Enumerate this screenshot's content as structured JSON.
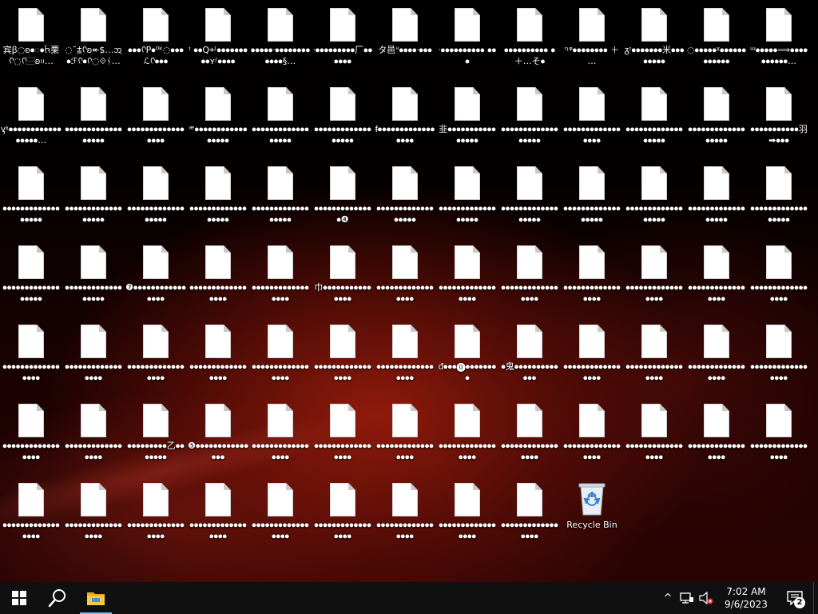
{
  "desktop": {
    "icons": [
      {
        "label": "宾ꞵ◌ꞝ⦁ᢆ⦁ᨪ栗ᢉ◌ᢉ⿱ꞝ᱿…",
        "type": "file"
      },
      {
        "label": "◌˘⩲ᢉꞝ↞$…ᩋ⦁ℱᢉ⦁ᢉ◌⟐ᚾ…",
        "type": "file"
      },
      {
        "label": "⦁⦁⦁ᢉP⦁⁰ᵏ◌⦁⦁⦁ℒᢉ⦁⦁⦁",
        "type": "file"
      },
      {
        "label": "ᶦ ⦁⦁Q⌖ᶴ⦁⦁⦁⦁⦁⦁⦁⦁⦁ʏᶴ⦁⦁⦁⦁",
        "type": "file"
      },
      {
        "label": "⦁⦁⦁⦁⦁ᐧ⦁⦁⦁⦁⦁⦁⦁⦁⦁⦁⦁⦁§…",
        "type": "file"
      },
      {
        "label": "ᐧ⦁⦁⦁⦁⦁⦁⦁⦁⦁厂⦁⦁⦁⦁⦁⦁",
        "type": "file"
      },
      {
        "label": "タ邑ᐡ⦁⦁⦁⦁ᐧ⦁⦁⦁",
        "type": "file"
      },
      {
        "label": "ᐧ⦁⦁⦁⦁⦁⦁⦁⦁⦁⦁ ⦁⦁⦁",
        "type": "file"
      },
      {
        "label": "⦁⦁⦁⦁⦁⦁⦁⦁⦁⦁ ⦁ ＋…そ⦁",
        "type": "file"
      },
      {
        "label": "ᶯᵠ⦁⦁⦁⦁⦁⦁⦁⦁ ＋ …",
        "type": "file"
      },
      {
        "label": "ᵹᶦ⦁⦁⦁⦁⦁⦁⦁米⦁⦁⦁⦁⦁⦁⦁⦁",
        "type": "file"
      },
      {
        "label": "◌⦁⦁⦁⦁⦁ᵡ⦁⦁⦁⦁⦁⦁⦁⦁⦁⦁⦁⦁",
        "type": "file"
      },
      {
        "label": "ᵚ⦁⦁⦁⦁⦁⟹⦁⦁⦁⦁⦁⦁⦁⦁⦁⦁…",
        "type": "file"
      },
      {
        "label": "ᶌᵡ⦁⦁⦁⦁⦁⦁⦁⦁⦁⦁⦁⦁⦁⦁⦁⦁⦁…",
        "type": "file"
      },
      {
        "label": "⦁⦁⦁⦁⦁⦁⦁⦁⦁⦁⦁⦁⦁⦁⦁⦁⦁⦁",
        "type": "file"
      },
      {
        "label": "⦁⦁⦁⦁⦁⦁⦁⦁⦁⦁⦁⦁⦁⦁⦁⦁⦁",
        "type": "file"
      },
      {
        "label": "ᵆ⦁⦁⦁⦁⦁⦁⦁⦁⦁⦁⦁⦁⦁⦁⦁⦁⦁",
        "type": "file"
      },
      {
        "label": "⦁⦁⦁⦁⦁⦁⦁⦁⦁⦁⦁⦁⦁⦁⦁⦁⦁⦁",
        "type": "file"
      },
      {
        "label": "⦁⦁⦁⦁⦁⦁⦁⦁⦁⦁⦁⦁⦁⦁⦁⦁⦁⦁",
        "type": "file"
      },
      {
        "label": "ᵮ⦁⦁⦁⦁⦁⦁⦁⦁⦁⦁⦁⦁⦁⦁⦁⦁⦁",
        "type": "file"
      },
      {
        "label": "韭⦁⦁⦁⦁⦁⦁⦁⦁⦁⦁⦁⦁⦁⦁⦁⦁",
        "type": "file"
      },
      {
        "label": "⦁⦁⦁⦁⦁⦁⦁⦁⦁⦁⦁⦁⦁⦁⦁⦁⦁⦁",
        "type": "file"
      },
      {
        "label": "⦁⦁⦁⦁⦁⦁⦁⦁⦁⦁⦁⦁⦁⦁⦁⦁⦁",
        "type": "file"
      },
      {
        "label": "⦁⦁⦁⦁⦁⦁⦁⦁⦁⦁⦁⦁⦁⦁⦁⦁⦁⦁",
        "type": "file"
      },
      {
        "label": "⦁⦁⦁⦁⦁⦁⦁⦁⦁⦁⦁⦁⦁⦁⦁⦁⦁⦁",
        "type": "file"
      },
      {
        "label": "⦁⦁⦁⦁⦁⦁⦁⦁⦁⦁⦁羽➡⦁⦁⦁",
        "type": "file"
      },
      {
        "label": "⦁⦁⦁⦁⦁⦁⦁⦁⦁⦁⦁⦁⦁⦁⦁⦁⦁⦁",
        "type": "file"
      },
      {
        "label": "⦁⦁⦁⦁⦁⦁⦁⦁⦁⦁⦁⦁⦁⦁⦁⦁⦁⦁",
        "type": "file"
      },
      {
        "label": "⦁⦁⦁⦁⦁⦁⦁⦁⦁⦁⦁⦁⦁⦁⦁⦁⦁⦁",
        "type": "file"
      },
      {
        "label": "⦁⦁⦁⦁⦁⦁⦁⦁⦁⦁⦁⦁⦁⦁⦁⦁⦁⦁",
        "type": "file"
      },
      {
        "label": "⦁⦁⦁⦁⦁⦁⦁⦁⦁⦁⦁⦁⦁⦁⦁⦁⦁⦁",
        "type": "file"
      },
      {
        "label": "⦁⦁⦁⦁⦁⦁⦁⦁⦁⦁⦁⦁⦁⦁❹",
        "type": "file"
      },
      {
        "label": "⦁⦁⦁⦁⦁⦁⦁⦁⦁⦁⦁⦁⦁⦁⦁⦁⦁⦁",
        "type": "file"
      },
      {
        "label": "⦁⦁⦁⦁⦁⦁⦁⦁⦁⦁⦁⦁⦁⦁⦁⦁⦁⦁",
        "type": "file"
      },
      {
        "label": "⦁⦁⦁⦁⦁⦁⦁⦁⦁⦁⦁⦁⦁⦁⦁⦁⦁⦁",
        "type": "file"
      },
      {
        "label": "⦁⦁⦁⦁⦁⦁⦁⦁⦁⦁⦁⦁⦁⦁⦁⦁⦁⦁",
        "type": "file"
      },
      {
        "label": "⦁⦁⦁⦁⦁⦁⦁⦁⦁⦁⦁⦁⦁⦁⦁⦁⦁⦁",
        "type": "file"
      },
      {
        "label": "⦁⦁⦁⦁⦁⦁⦁⦁⦁⦁⦁⦁⦁⦁⦁⦁⦁⦁",
        "type": "file"
      },
      {
        "label": "⦁⦁⦁⦁⦁⦁⦁⦁⦁⦁⦁⦁⦁⦁⦁⦁⦁⦁",
        "type": "file"
      },
      {
        "label": "⦁⦁⦁⦁⦁⦁⦁⦁⦁⦁⦁⦁⦁⦁⦁⦁⦁⦁",
        "type": "file"
      },
      {
        "label": "⦁⦁⦁⦁⦁⦁⦁⦁⦁⦁⦁⦁⦁⦁⦁⦁⦁⦁",
        "type": "file"
      },
      {
        "label": "❼⦁⦁⦁⦁⦁⦁⦁⦁⦁⦁⦁⦁⦁⦁⦁⦁",
        "type": "file"
      },
      {
        "label": "⦁⦁⦁⦁⦁⦁⦁⦁⦁⦁⦁⦁⦁⦁⦁⦁⦁",
        "type": "file"
      },
      {
        "label": "⦁⦁⦁⦁⦁⦁⦁⦁⦁⦁⦁⦁⦁⦁⦁⦁⦁",
        "type": "file"
      },
      {
        "label": "巾⦁⦁⦁⦁⦁⦁⦁⦁⦁⦁⦁⦁⦁⦁⦁",
        "type": "file"
      },
      {
        "label": "⦁⦁⦁⦁⦁⦁⦁⦁⦁⦁⦁⦁⦁⦁⦁⦁⦁",
        "type": "file"
      },
      {
        "label": "⦁⦁⦁⦁⦁⦁⦁⦁⦁⦁⦁⦁⦁⦁⦁⦁⦁",
        "type": "file"
      },
      {
        "label": "⦁⦁⦁⦁⦁⦁⦁⦁⦁⦁⦁⦁⦁⦁⦁⦁⦁",
        "type": "file"
      },
      {
        "label": "⦁⦁⦁⦁⦁⦁⦁⦁⦁⦁⦁⦁⦁⦁⦁⦁⦁",
        "type": "file"
      },
      {
        "label": "⦁⦁⦁⦁⦁⦁⦁⦁⦁⦁⦁⦁⦁⦁⦁⦁⦁",
        "type": "file"
      },
      {
        "label": "⦁⦁⦁⦁⦁⦁⦁⦁⦁⦁⦁⦁⦁⦁⦁⦁⦁",
        "type": "file"
      },
      {
        "label": "⦁⦁⦁⦁⦁⦁⦁⦁⦁⦁⦁⦁⦁⦁⦁⦁⦁",
        "type": "file"
      },
      {
        "label": "⦁⦁⦁⦁⦁⦁⦁⦁⦁⦁⦁⦁⦁⦁⦁⦁⦁",
        "type": "file"
      },
      {
        "label": "⦁⦁⦁⦁⦁⦁⦁⦁⦁⦁⦁⦁⦁⦁⦁⦁⦁",
        "type": "file"
      },
      {
        "label": "⦁⦁⦁⦁⦁⦁⦁⦁⦁⦁⦁⦁⦁⦁⦁⦁⦁",
        "type": "file"
      },
      {
        "label": "⦁⦁⦁⦁⦁⦁⦁⦁⦁⦁⦁⦁⦁⦁⦁⦁⦁",
        "type": "file"
      },
      {
        "label": "⦁⦁⦁⦁⦁⦁⦁⦁⦁⦁⦁⦁⦁⦁⦁⦁⦁",
        "type": "file"
      },
      {
        "label": "⦁⦁⦁⦁⦁⦁⦁⦁⦁⦁⦁⦁⦁⦁⦁⦁⦁",
        "type": "file"
      },
      {
        "label": "⦁⦁⦁⦁⦁⦁⦁⦁⦁⦁⦁⦁⦁⦁⦁⦁⦁",
        "type": "file"
      },
      {
        "label": "ᵭ⦁⦁⦁⓿⦁⦁⦁⦁⦁⦁⦁⦁",
        "type": "file"
      },
      {
        "label": "⦁鬼⦁⦁⦁⦁⦁⦁⦁⦁⦁⦁⦁⦁⦁",
        "type": "file"
      },
      {
        "label": "⦁⦁⦁⦁⦁⦁⦁⦁⦁⦁⦁⦁⦁⦁⦁⦁⦁",
        "type": "file"
      },
      {
        "label": "⦁⦁⦁⦁⦁⦁⦁⦁⦁⦁⦁⦁⦁⦁⦁⦁⦁",
        "type": "file"
      },
      {
        "label": "⦁⦁⦁⦁⦁⦁⦁⦁⦁⦁⦁⦁⦁⦁⦁⦁⦁",
        "type": "file"
      },
      {
        "label": "⦁⦁⦁⦁⦁⦁⦁⦁⦁⦁⦁⦁⦁⦁⦁⦁⦁",
        "type": "file"
      },
      {
        "label": "⦁⦁⦁⦁⦁⦁⦁⦁⦁⦁⦁⦁⦁⦁⦁⦁⦁",
        "type": "file"
      },
      {
        "label": "⦁⦁⦁⦁⦁⦁⦁⦁⦁⦁⦁⦁⦁⦁⦁⦁⦁",
        "type": "file"
      },
      {
        "label": "⦁⦁⦁⦁⦁⦁⦁⦁⦁乙⦁⦁⦁⦁⦁⦁⦁",
        "type": "file"
      },
      {
        "label": "❺⦁⦁⦁⦁⦁⦁⦁⦁⦁⦁⦁⦁⦁⦁⦁",
        "type": "file"
      },
      {
        "label": "⦁⦁⦁⦁⦁⦁⦁⦁⦁⦁⦁⦁⦁⦁⦁⦁⦁",
        "type": "file"
      },
      {
        "label": "⦁⦁⦁⦁⦁⦁⦁⦁⦁⦁⦁⦁⦁⦁⦁⦁⦁",
        "type": "file"
      },
      {
        "label": "⦁⦁⦁⦁⦁⦁⦁⦁⦁⦁⦁⦁⦁⦁⦁⦁⦁",
        "type": "file"
      },
      {
        "label": "⦁⦁⦁⦁⦁⦁⦁⦁⦁⦁⦁⦁⦁⦁⦁⦁⦁",
        "type": "file"
      },
      {
        "label": "⦁⦁⦁⦁⦁⦁⦁⦁⦁⦁⦁⦁⦁⦁⦁⦁⦁",
        "type": "file"
      },
      {
        "label": "⦁⦁⦁⦁⦁⦁⦁⦁⦁⦁⦁⦁⦁⦁⦁⦁⦁",
        "type": "file"
      },
      {
        "label": "⦁⦁⦁⦁⦁⦁⦁⦁⦁⦁⦁⦁⦁⦁⦁⦁⦁",
        "type": "file"
      },
      {
        "label": "⦁⦁⦁⦁⦁⦁⦁⦁⦁⦁⦁⦁⦁⦁⦁⦁⦁",
        "type": "file"
      },
      {
        "label": "⦁⦁⦁⦁⦁⦁⦁⦁⦁⦁⦁⦁⦁⦁⦁⦁⦁",
        "type": "file"
      },
      {
        "label": "⦁⦁⦁⦁⦁⦁⦁⦁⦁⦁⦁⦁⦁⦁⦁⦁⦁",
        "type": "file"
      },
      {
        "label": "⦁⦁⦁⦁⦁⦁⦁⦁⦁⦁⦁⦁⦁⦁⦁⦁⦁",
        "type": "file"
      },
      {
        "label": "⦁⦁⦁⦁⦁⦁⦁⦁⦁⦁⦁⦁⦁⦁⦁⦁⦁",
        "type": "file"
      },
      {
        "label": "⦁⦁⦁⦁⦁⦁⦁⦁⦁⦁⦁⦁⦁⦁⦁⦁⦁",
        "type": "file"
      },
      {
        "label": "⦁⦁⦁⦁⦁⦁⦁⦁⦁⦁⦁⦁⦁⦁⦁⦁⦁",
        "type": "file"
      },
      {
        "label": "⦁⦁⦁⦁⦁⦁⦁⦁⦁⦁⦁⦁⦁⦁⦁⦁⦁",
        "type": "file"
      },
      {
        "label": "⦁⦁⦁⦁⦁⦁⦁⦁⦁⦁⦁⦁⦁⦁⦁⦁⦁",
        "type": "file"
      },
      {
        "label": "⦁⦁⦁⦁⦁⦁⦁⦁⦁⦁⦁⦁⦁⦁⦁⦁⦁",
        "type": "file"
      },
      {
        "label": "⦁⦁⦁⦁⦁⦁⦁⦁⦁⦁⦁⦁⦁⦁⦁⦁⦁",
        "type": "file"
      },
      {
        "label": "Recycle Bin",
        "type": "recycle-bin"
      }
    ]
  },
  "taskbar": {
    "start_icon": "windows-logo-icon",
    "search_icon": "search-icon",
    "explorer_icon": "file-explorer-icon",
    "tray": {
      "chevron": "^",
      "network_icon": "network-icon",
      "volume_icon": "volume-muted-icon",
      "time": "7:02 AM",
      "date": "9/6/2023",
      "notification_count": "2"
    }
  },
  "colors": {
    "accent": "#76b9ed",
    "taskbar_bg": "#101010",
    "wallpaper_red": "#9a1c0c"
  }
}
